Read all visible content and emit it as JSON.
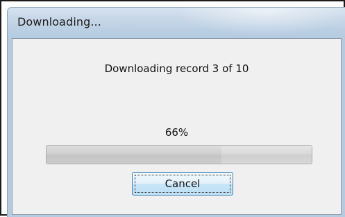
{
  "window": {
    "title": "Downloading..."
  },
  "dialog": {
    "message": "Downloading record 3 of 10",
    "percent_label": "66%",
    "progress_fraction": 0.66
  },
  "buttons": {
    "cancel_label": "Cancel"
  },
  "colors": {
    "titlebar": "#c9d8e8",
    "client_bg": "#f0f0f0",
    "button_border": "#3c7fb1"
  }
}
